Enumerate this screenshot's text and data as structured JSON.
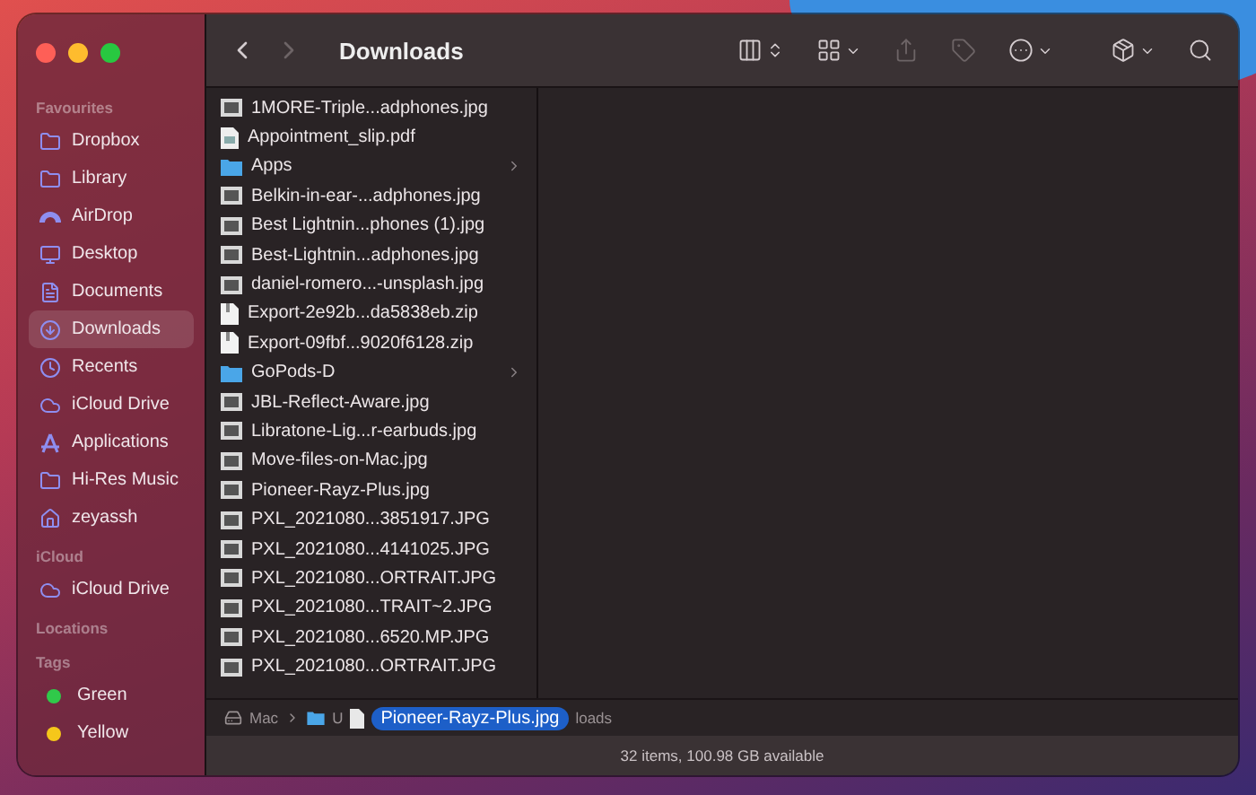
{
  "window": {
    "title": "Downloads"
  },
  "toolbar": [
    {
      "kind": "columns",
      "disabled": false
    },
    {
      "kind": "grid",
      "disabled": false
    },
    {
      "kind": "share",
      "disabled": true
    },
    {
      "kind": "tag",
      "disabled": true
    },
    {
      "kind": "more",
      "disabled": false
    },
    {
      "kind": "dropbox",
      "disabled": false
    },
    {
      "kind": "search",
      "disabled": false
    }
  ],
  "sidebar": [
    {
      "heading": "Favourites",
      "items": [
        {
          "label": "Dropbox",
          "kind": "folder",
          "selected": false
        },
        {
          "label": "Library",
          "kind": "folder",
          "selected": false
        },
        {
          "label": "AirDrop",
          "kind": "airdrop",
          "selected": false
        },
        {
          "label": "Desktop",
          "kind": "desktop",
          "selected": false
        },
        {
          "label": "Documents",
          "kind": "document",
          "selected": false
        },
        {
          "label": "Downloads",
          "kind": "downloads",
          "selected": true
        },
        {
          "label": "Recents",
          "kind": "recents",
          "selected": false
        },
        {
          "label": "iCloud Drive",
          "kind": "cloud",
          "selected": false
        },
        {
          "label": "Applications",
          "kind": "applications",
          "selected": false
        },
        {
          "label": "Hi-Res Music",
          "kind": "folder",
          "selected": false
        },
        {
          "label": "zeyassh",
          "kind": "home",
          "selected": false
        }
      ]
    },
    {
      "heading": "iCloud",
      "items": [
        {
          "label": "iCloud Drive",
          "kind": "cloud",
          "selected": false
        }
      ]
    },
    {
      "heading": "Locations"
    },
    {
      "heading": "Tags",
      "items": [
        {
          "label": "Green",
          "kind": "tag",
          "color": "#30c94a",
          "selected": false
        },
        {
          "label": "Yellow",
          "kind": "tag",
          "color": "#f5c71a",
          "selected": false
        }
      ]
    }
  ],
  "files": [
    {
      "name": "1MORE-Triple...adphones.jpg",
      "kind": "image"
    },
    {
      "name": "Appointment_slip.pdf",
      "kind": "pdf"
    },
    {
      "name": "Apps",
      "kind": "folder"
    },
    {
      "name": "Belkin-in-ear-...adphones.jpg",
      "kind": "image"
    },
    {
      "name": "Best Lightnin...phones (1).jpg",
      "kind": "image"
    },
    {
      "name": "Best-Lightnin...adphones.jpg",
      "kind": "image"
    },
    {
      "name": "daniel-romero...-unsplash.jpg",
      "kind": "image"
    },
    {
      "name": "Export-2e92b...da5838eb.zip",
      "kind": "zip"
    },
    {
      "name": "Export-09fbf...9020f6128.zip",
      "kind": "zip"
    },
    {
      "name": "GoPods-D",
      "kind": "folder"
    },
    {
      "name": "JBL-Reflect-Aware.jpg",
      "kind": "image"
    },
    {
      "name": "Libratone-Lig...r-earbuds.jpg",
      "kind": "image"
    },
    {
      "name": "Move-files-on-Mac.jpg",
      "kind": "image"
    },
    {
      "name": "Pioneer-Rayz-Plus.jpg",
      "kind": "image"
    },
    {
      "name": "PXL_2021080...3851917.JPG",
      "kind": "image"
    },
    {
      "name": "PXL_2021080...4141025.JPG",
      "kind": "image"
    },
    {
      "name": "PXL_2021080...ORTRAIT.JPG",
      "kind": "image"
    },
    {
      "name": "PXL_2021080...TRAIT~2.JPG",
      "kind": "image"
    },
    {
      "name": "PXL_2021080...6520.MP.JPG",
      "kind": "image"
    },
    {
      "name": "PXL_2021080...ORTRAIT.JPG",
      "kind": "image"
    }
  ],
  "path_bar": {
    "items": [
      {
        "label": "Mac",
        "kind": "disk"
      },
      {
        "label": "U",
        "kind": "folder"
      },
      {
        "label": "loads",
        "kind": "plain"
      }
    ],
    "dragged_file": "Pioneer-Rayz-Plus.jpg"
  },
  "status_bar": "32 items, 100.98 GB available"
}
